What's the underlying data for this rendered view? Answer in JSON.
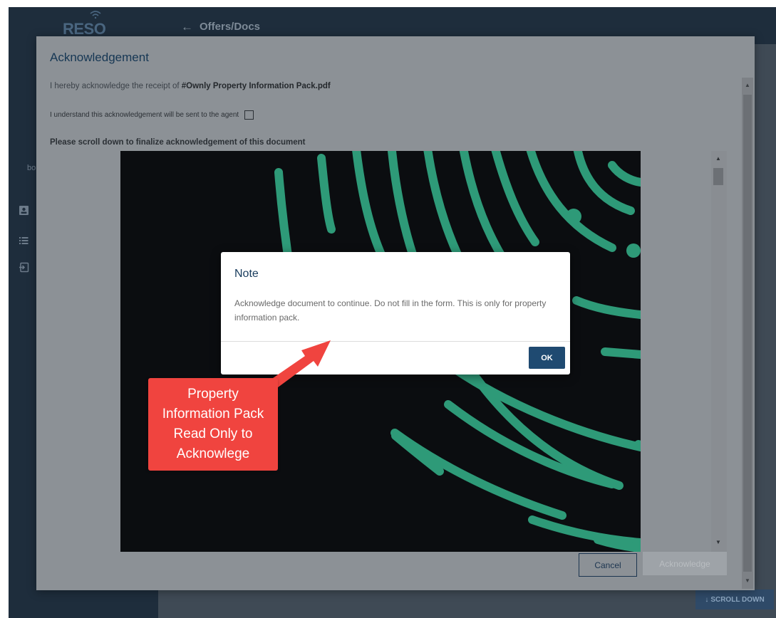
{
  "app": {
    "logo": "RESO",
    "page_title": "Offers/Docs",
    "sidebar_truncated_text": "bo",
    "sidebar_icons": [
      "contact-card-icon",
      "list-icon",
      "sign-in-icon"
    ],
    "scroll_down_label": "SCROLL DOWN"
  },
  "dialog": {
    "title": "Acknowledgement",
    "receipt_prefix": "I hereby acknowledge the receipt of ",
    "receipt_file": "#Ownly Property Information Pack.pdf",
    "checkbox_label": "I understand this acknowledgement will be sent to the agent",
    "checkbox_checked": false,
    "scroll_note": "Please scroll down to finalize acknowledgement of this document",
    "cancel_label": "Cancel",
    "acknowledge_label": "Acknowledge"
  },
  "note": {
    "title": "Note",
    "body": "Acknowledge document to continue. Do not fill in the form. This is only for property information pack.",
    "ok_label": "OK"
  },
  "annotation": {
    "text": "Property\nInformation Pack\nRead Only to\nAcknowlege"
  },
  "colors": {
    "topbar": "#1e2d3c",
    "overlay_dialog": "#8c9196",
    "document_background": "#0b0d10",
    "document_accent": "#2e9a78",
    "ok_button": "#1f4a71",
    "annotation": "#f0443f"
  }
}
